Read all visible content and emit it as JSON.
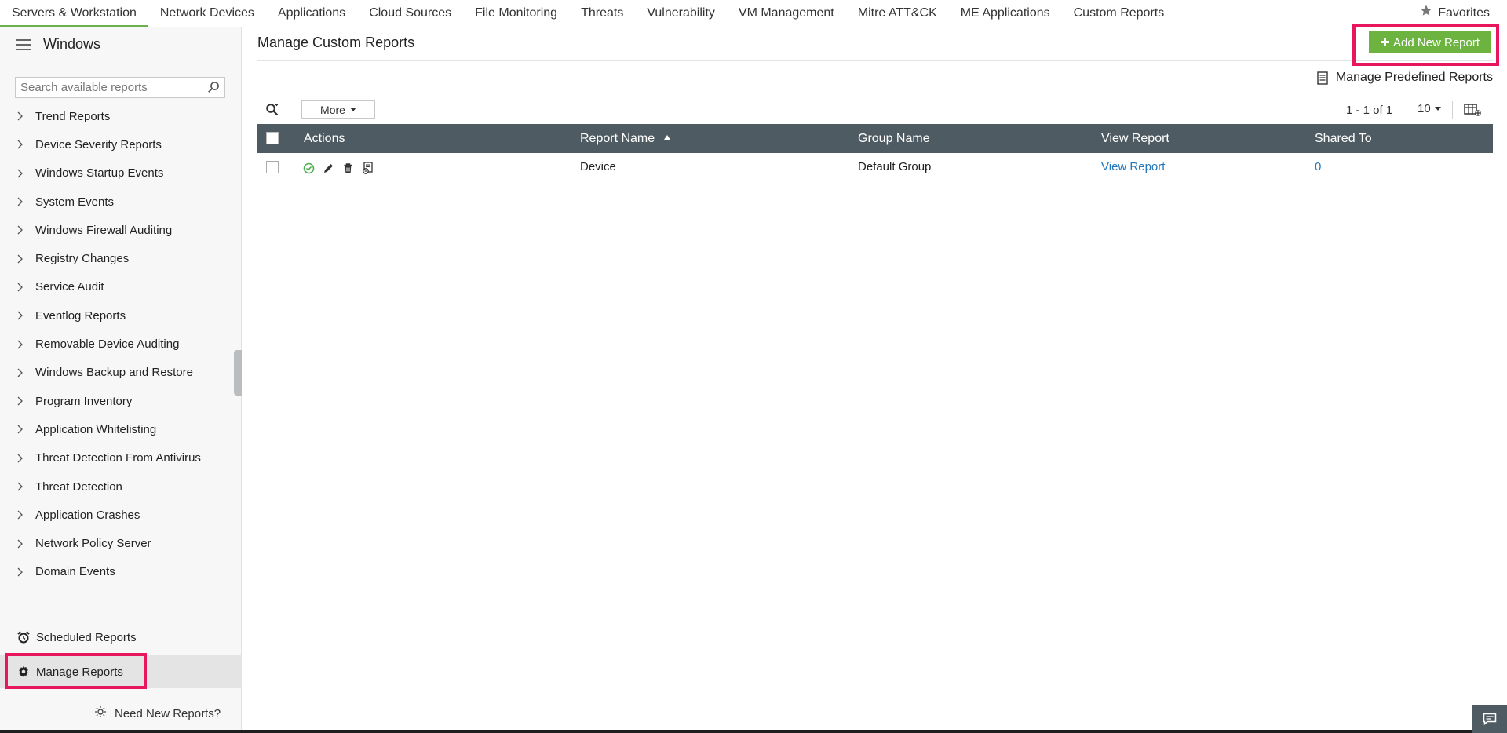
{
  "topnav": {
    "tabs": [
      {
        "label": "Servers & Workstation"
      },
      {
        "label": "Network Devices"
      },
      {
        "label": "Applications"
      },
      {
        "label": "Cloud Sources"
      },
      {
        "label": "File Monitoring"
      },
      {
        "label": "Threats"
      },
      {
        "label": "Vulnerability"
      },
      {
        "label": "VM Management"
      },
      {
        "label": "Mitre ATT&CK"
      },
      {
        "label": "ME Applications"
      },
      {
        "label": "Custom Reports"
      }
    ],
    "active_tab": "Servers & Workstation",
    "favorites_label": "Favorites"
  },
  "sidebar": {
    "title": "Windows",
    "search_placeholder": "Search available reports",
    "items": [
      {
        "label": "Trend Reports"
      },
      {
        "label": "Device Severity Reports"
      },
      {
        "label": "Windows Startup Events"
      },
      {
        "label": "System Events"
      },
      {
        "label": "Windows Firewall Auditing"
      },
      {
        "label": "Registry Changes"
      },
      {
        "label": "Service Audit"
      },
      {
        "label": "Eventlog Reports"
      },
      {
        "label": "Removable Device Auditing"
      },
      {
        "label": "Windows Backup and Restore"
      },
      {
        "label": "Program Inventory"
      },
      {
        "label": "Application Whitelisting"
      },
      {
        "label": "Threat Detection From Antivirus"
      },
      {
        "label": "Threat Detection"
      },
      {
        "label": "Application Crashes"
      },
      {
        "label": "Network Policy Server"
      },
      {
        "label": "Domain Events"
      }
    ],
    "scheduled_reports_label": "Scheduled Reports",
    "manage_reports_label": "Manage Reports",
    "need_new_reports_label": "Need New Reports?"
  },
  "main": {
    "title": "Manage Custom Reports",
    "add_button_label": "Add New Report",
    "predefined_link_label": "Manage Predefined Reports",
    "toolbar": {
      "more_label": "More",
      "pager_text": "1 - 1 of 1",
      "page_size": "10"
    },
    "grid": {
      "columns": {
        "actions": "Actions",
        "report_name": "Report Name",
        "group_name": "Group Name",
        "view_report": "View Report",
        "shared_to": "Shared To"
      },
      "rows": [
        {
          "report_name": "Device",
          "group_name": "Default Group",
          "view_report": "View Report",
          "shared_to": "0"
        }
      ]
    }
  },
  "colors": {
    "accent_green": "#6cb33f",
    "grid_header": "#4f5b62",
    "link_blue": "#2277bb",
    "highlight_pink": "#e8175d"
  }
}
